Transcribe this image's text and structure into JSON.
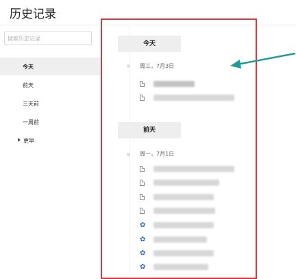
{
  "page": {
    "title": "历史记录"
  },
  "search": {
    "placeholder": "搜索历史记录"
  },
  "sidebar": {
    "items": [
      {
        "label": "今天",
        "active": true
      },
      {
        "label": "前天",
        "active": false
      },
      {
        "label": "三天前",
        "active": false
      },
      {
        "label": "一周前",
        "active": false
      },
      {
        "label": "更早",
        "active": false,
        "expandable": true
      }
    ]
  },
  "timeline": {
    "groups": [
      {
        "header": "今天",
        "date": "周三，7月3日",
        "entries": [
          {
            "icon": "document-icon"
          },
          {
            "icon": "document-icon"
          }
        ]
      },
      {
        "header": "前天",
        "date": "周一，7月1日",
        "entries": [
          {
            "icon": "document-icon"
          },
          {
            "icon": "document-icon"
          },
          {
            "icon": "document-icon"
          },
          {
            "icon": "document-icon"
          },
          {
            "icon": "baidu-paw-icon"
          },
          {
            "icon": "baidu-paw-icon"
          },
          {
            "icon": "baidu-paw-icon"
          },
          {
            "icon": "baidu-paw-icon"
          }
        ]
      }
    ]
  },
  "colors": {
    "highlight": "#e0343a",
    "arrow": "#1f9a96",
    "paw": "#2f65d6"
  }
}
